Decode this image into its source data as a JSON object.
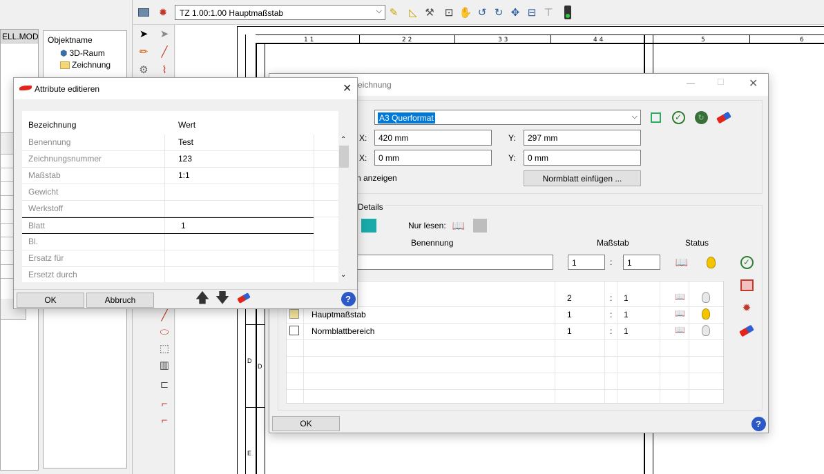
{
  "left_panel": {
    "model_header": "ELL.MOD",
    "object_header": "Objektname",
    "objects": [
      "3D-Raum",
      "Zeichnung"
    ]
  },
  "toolbar": {
    "scale_select": "TZ 1.00:1.00 Hauptmaßstab"
  },
  "ruler": {
    "numbers": [
      "1 1",
      "2 2",
      "3 3",
      "4 4",
      "5",
      "6"
    ],
    "row_letters": [
      "D",
      "D",
      "E"
    ]
  },
  "drawing_dialog": {
    "title": "eichnung",
    "format_select": "A3 Querformat",
    "size_x_label": "X:",
    "size_x": "420 mm",
    "size_y_label": "Y:",
    "size_y": "297 mm",
    "offset_x_label": "X:",
    "offset_x": "0 mm",
    "offset_y_label": "Y:",
    "offset_y": "0 mm",
    "show_label": "n anzeigen",
    "insert_button": "Normblatt einfügen ...",
    "details_legend": "Details",
    "readonly_label": "Nur lesen:",
    "col_name": "Benennung",
    "col_scale": "Maßstab",
    "col_status": "Status",
    "new_scale_a": "1",
    "new_scale_b": "1",
    "colon": ":",
    "rows": [
      {
        "name": "",
        "a": "2",
        "b": "1",
        "bulb": "off"
      },
      {
        "name": "Hauptmaßstab",
        "a": "1",
        "b": "1",
        "bulb": "on"
      },
      {
        "name": "Normblattbereich",
        "a": "1",
        "b": "1",
        "bulb": "off"
      }
    ],
    "ok": "OK"
  },
  "attr_dialog": {
    "title": "Attribute editieren",
    "col_name": "Bezeichnung",
    "col_value": "Wert",
    "rows": [
      {
        "name": "Benennung",
        "value": "Test"
      },
      {
        "name": "Zeichnungsnummer",
        "value": "123"
      },
      {
        "name": "Maßstab",
        "value": "1:1"
      },
      {
        "name": "Gewicht",
        "value": ""
      },
      {
        "name": "Werkstoff",
        "value": ""
      },
      {
        "name": "Blatt",
        "value": "1"
      },
      {
        "name": "Bl.",
        "value": ""
      },
      {
        "name": "Ersatz für",
        "value": ""
      },
      {
        "name": "Ersetzt durch",
        "value": ""
      }
    ],
    "ok": "OK",
    "cancel": "Abbruch"
  },
  "colors": {
    "teal": "#19aaa9",
    "selection": "#0078d7",
    "help": "#2d58c8",
    "bulb_on": "#f3c400"
  }
}
